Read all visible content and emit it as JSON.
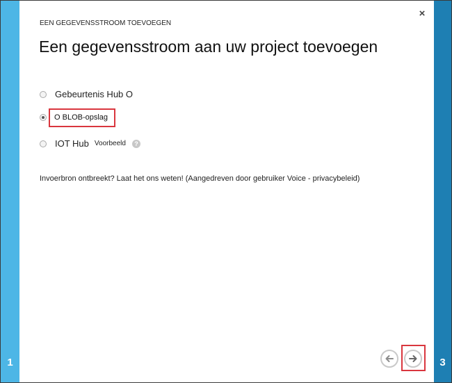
{
  "wizard": {
    "step_left": "1",
    "step_right": "3",
    "close_label": "×",
    "subtitle": "EEN GEGEVENSSTROOM TOEVOEGEN",
    "title": "Een gegevensstroom aan uw project toevoegen"
  },
  "options": [
    {
      "label": "Gebeurtenis Hub O",
      "selected": false
    },
    {
      "label": "O BLOB-opslag",
      "selected": true
    },
    {
      "label": "IOT Hub",
      "tag": "Voorbeeld",
      "help": "?",
      "selected": false
    }
  ],
  "feedback": {
    "text": "Invoerbron ontbreekt? Laat het ons weten! (Aangedreven door gebruiker Voice - privacybeleid)"
  },
  "navigation": {
    "prev_icon": "arrow-left-icon",
    "next_icon": "arrow-right-icon"
  },
  "colors": {
    "left_strip": "#4db6e6",
    "right_strip": "#1e7fb3",
    "highlight": "#d9363e"
  }
}
